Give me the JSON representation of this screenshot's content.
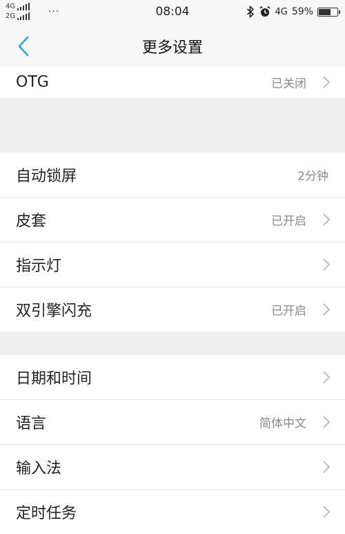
{
  "status_bar": {
    "net1": "4G",
    "net2": "2G",
    "more": "···",
    "time": "08:04",
    "lte": "4G",
    "battery": "59%",
    "battery_level": 0.59,
    "icons": [
      "bluetooth-icon",
      "alarm-icon",
      "battery-icon"
    ]
  },
  "nav": {
    "title": "更多设置",
    "back_icon": "chevron-left-icon",
    "accent": "#2aa7e6"
  },
  "settings": {
    "otg": {
      "label": "OTG",
      "value": "已关闭"
    },
    "auto_lock": {
      "label": "自动锁屏",
      "value": "2分钟"
    },
    "case": {
      "label": "皮套",
      "value": "已开启"
    },
    "indicator": {
      "label": "指示灯",
      "value": ""
    },
    "dual_engine": {
      "label": "双引擎闪充",
      "value": "已开启"
    },
    "date_time": {
      "label": "日期和时间",
      "value": ""
    },
    "language": {
      "label": "语言",
      "value": "简体中文"
    },
    "input_method": {
      "label": "输入法",
      "value": ""
    },
    "scheduled_tasks": {
      "label": "定时任务",
      "value": ""
    }
  }
}
